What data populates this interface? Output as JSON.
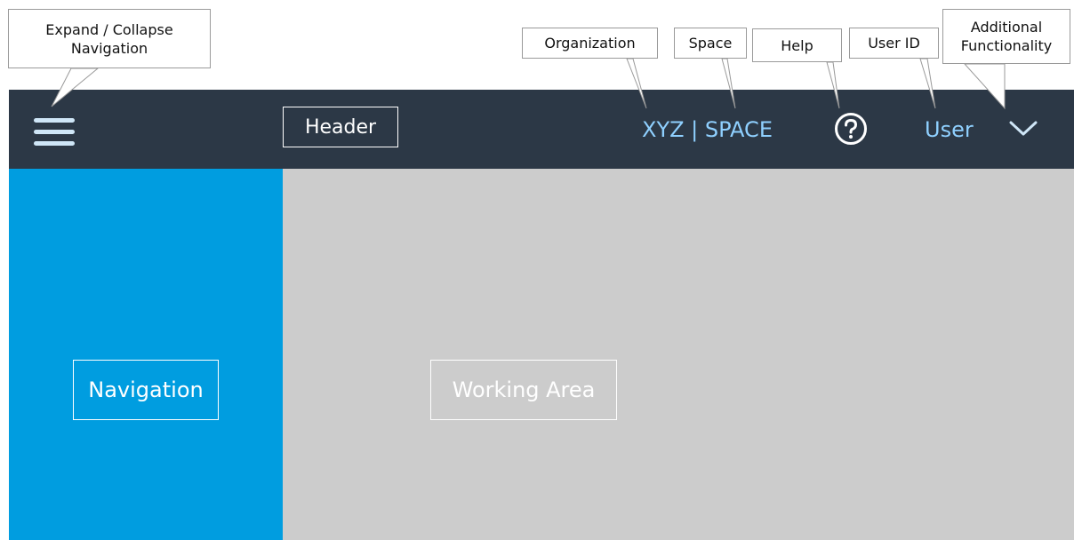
{
  "header": {
    "label": "Header",
    "organization_space": "XYZ | SPACE",
    "user": "User",
    "icons": {
      "menu": "hamburger-icon",
      "help": "help-circle-icon",
      "more": "chevron-down-icon"
    }
  },
  "navigation": {
    "label": "Navigation"
  },
  "working_area": {
    "label": "Working Area"
  },
  "callouts": {
    "expand_collapse": "Expand / Collapse\nNavigation",
    "organization": "Organization",
    "space": "Space",
    "help": "Help",
    "user_id": "User ID",
    "additional": "Additional\nFunctionality"
  },
  "colors": {
    "header_bg": "#2c3846",
    "navigation_bg": "#009de0",
    "working_area_bg": "#cccccc",
    "header_text_accent": "#8fd0ff"
  }
}
